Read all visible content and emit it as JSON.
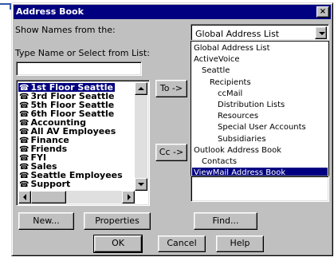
{
  "window": {
    "title": "Address Book",
    "close_glyph": "×"
  },
  "show_names": {
    "label": "Show Names from the:",
    "selected": "Global Address List",
    "options": [
      {
        "label": "Global Address List",
        "indent": 0
      },
      {
        "label": "ActiveVoice",
        "indent": 0
      },
      {
        "label": "Seattle",
        "indent": 1
      },
      {
        "label": "Recipients",
        "indent": 2
      },
      {
        "label": "ccMail",
        "indent": 3
      },
      {
        "label": "Distribution Lists",
        "indent": 3
      },
      {
        "label": "Resources",
        "indent": 3
      },
      {
        "label": "Special User Accounts",
        "indent": 3
      },
      {
        "label": "Subsidiaries",
        "indent": 3
      },
      {
        "label": "Outlook Address Book",
        "indent": 0
      },
      {
        "label": "Contacts",
        "indent": 1
      },
      {
        "label": "ViewMail Address Book",
        "indent": 0,
        "selected": true
      }
    ]
  },
  "type_name": {
    "label": "Type Name or Select from List:",
    "value": ""
  },
  "names": [
    {
      "label": "1st Floor Seattle",
      "selected": true
    },
    {
      "label": "3rd Floor Seattle"
    },
    {
      "label": "5th Floor Seattle"
    },
    {
      "label": "6th Floor Seattle"
    },
    {
      "label": "Accounting"
    },
    {
      "label": "All AV Employees"
    },
    {
      "label": "Finance"
    },
    {
      "label": "Friends"
    },
    {
      "label": "FYI"
    },
    {
      "label": "Sales"
    },
    {
      "label": "Seattle Employees"
    },
    {
      "label": "Support"
    }
  ],
  "name_icon": "group-icon",
  "buttons": {
    "to": "To ->",
    "cc": "Cc ->",
    "new": "New...",
    "properties": "Properties",
    "find": "Find...",
    "ok": "OK",
    "cancel": "Cancel",
    "help": "Help"
  },
  "colors": {
    "title_bar": "#000080",
    "selection": "#000080",
    "face": "#c0c0c0",
    "accent": "#2f57a6"
  }
}
